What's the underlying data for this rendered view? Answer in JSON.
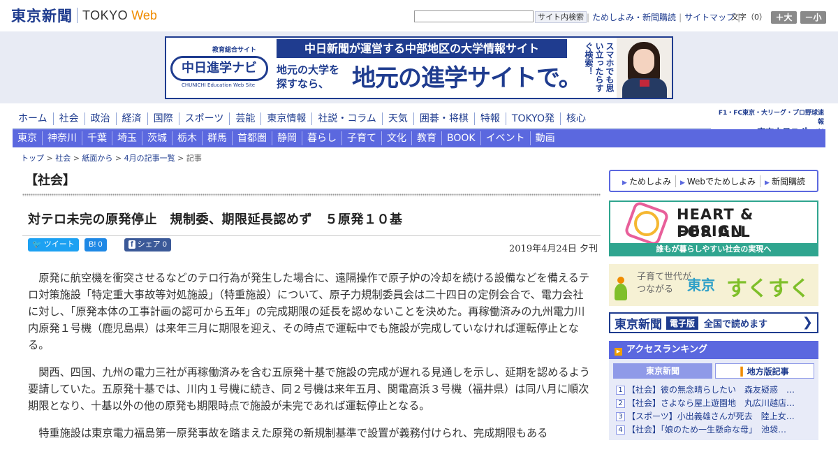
{
  "header": {
    "logo_jp": "東京新聞",
    "logo_en": "TOKYO",
    "logo_web": "Web",
    "search_placeholder": "",
    "search_button": "サイト内検索",
    "links": [
      "ためしよみ・新聞購読",
      "サイトマップ"
    ],
    "font_size_label": "文字（0）",
    "font_bigger": "＋大",
    "font_smaller": "－小"
  },
  "banner": {
    "logo_small": "教育総合サイト",
    "logo_main": "中日進学ナビ",
    "logo_tiny": "CHUNICHI Education Web Site",
    "top_text": "中日新聞が運営する中部地区の大学情報サイト",
    "left_text": "地元の大学を探すなら、",
    "main_text": "地元の進学サイトで。",
    "vertical_text": "スマホでも思い立ったらすぐ検索！"
  },
  "nav_primary": [
    "ホーム",
    "社会",
    "政治",
    "経済",
    "国際",
    "スポーツ",
    "芸能",
    "東京情報",
    "社説・コラム",
    "天気",
    "囲碁・将棋",
    "特報",
    "TOKYO発",
    "核心"
  ],
  "chunichi_sports": {
    "line1": "F1・FC東京・大リーグ・プロ野球速報",
    "line2": "東京中日スポーツ"
  },
  "nav_secondary": [
    "東京",
    "神奈川",
    "千葉",
    "埼玉",
    "茨城",
    "栃木",
    "群馬",
    "首都圏",
    "静岡",
    "暮らし",
    "子育て",
    "文化",
    "教育",
    "BOOK",
    "イベント",
    "動画"
  ],
  "breadcrumb": [
    "トップ",
    "社会",
    "紙面から",
    "4月の記事一覧",
    "記事"
  ],
  "article": {
    "section": "【社会】",
    "title": "対テロ未完の原発停止　規制委、期限延長認めず　５原発１０基",
    "share_tweet": "ツイート",
    "share_hatena": "B! 0",
    "share_facebook": "シェア 0",
    "date": "2019年4月24日 夕刊",
    "paragraphs": [
      "原発に航空機を衝突させるなどのテロ行為が発生した場合に、遠隔操作で原子炉の冷却を続ける設備などを備えるテロ対策施設「特定重大事故等対処施設」（特重施設）について、原子力規制委員会は二十四日の定例会合で、電力会社に対し、「原発本体の工事計画の認可から五年」の完成期限の延長を認めないことを決めた。再稼働済みの九州電力川内原発１号機（鹿児島県）は来年三月に期限を迎え、その時点で運転中でも施設が完成していなければ運転停止となる。",
      "関西、四国、九州の電力三社が再稼働済みを含む五原発十基で施設の完成が遅れる見通しを示し、延期を認めるよう要請していた。五原発十基では、川内１号機に続き、同２号機は来年五月、関電高浜３号機（福井県）は同八月に順次期限となり、十基以外の他の原発も期限時点で施設が未完であれば運転停止となる。",
      "特重施設は東京電力福島第一原発事故を踏まえた原発の新規制基準で設置が義務付けられ、完成期限もある"
    ]
  },
  "sidebar": {
    "links": [
      "ためしよみ",
      "Webでためしよみ",
      "新聞購読"
    ],
    "heart_design_line1": "HEART & DESIGN",
    "heart_design_line2": "FOR ALL",
    "heart_design_sub": "誰もが暮らしやすい社会の実現へ",
    "sukusuku_small": "子育て世代が\nつながる",
    "sukusuku_tokyo": "東京",
    "sukusuku_main": "すくすく",
    "digital_logo": "東京新聞",
    "digital_badge": "電子版",
    "digital_text": "全国で読めます",
    "ranking_title": "アクセスランキング",
    "ranking_tabs": [
      "東京新聞",
      "地方版記事"
    ],
    "ranking": [
      {
        "num": "1",
        "text": "【社会】彼の無念晴らしたい　森友疑惑　…"
      },
      {
        "num": "2",
        "text": "【社会】さよなら屋上遊園地　丸広川越店…"
      },
      {
        "num": "3",
        "text": "【スポーツ】小出義雄さんが死去　陸上女…"
      },
      {
        "num": "4",
        "text": "【社会】「娘のため一生懸命な母」　池袋…"
      }
    ]
  }
}
